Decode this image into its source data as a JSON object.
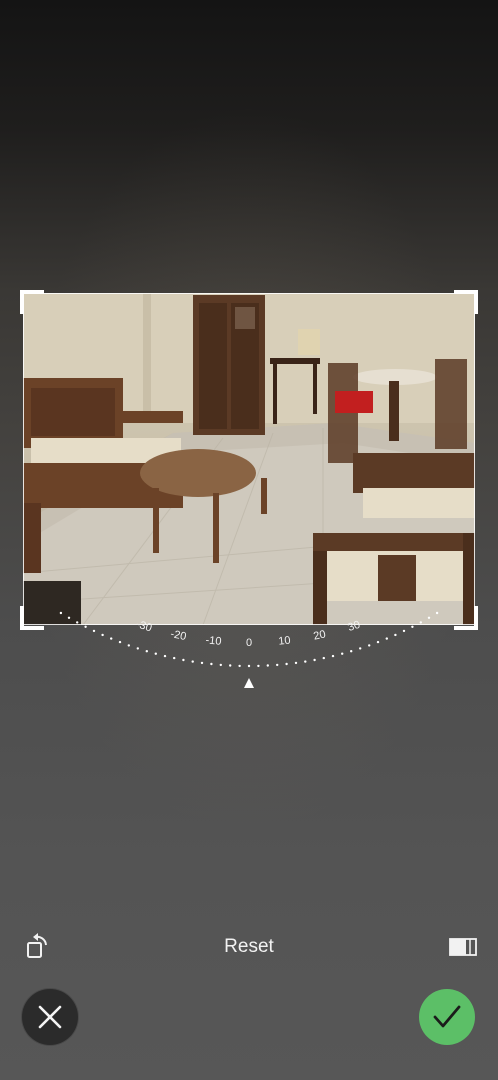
{
  "photo": {
    "subject": "living-room-photo"
  },
  "dial": {
    "ticks": [
      "-30",
      "-20",
      "-10",
      "0",
      "10",
      "20",
      "30"
    ],
    "current_angle": 0
  },
  "toolbar": {
    "reset_label": "Reset",
    "rotate_icon": "rotate-icon",
    "aspect_icon": "aspect-ratio-icon"
  },
  "actions": {
    "cancel_icon": "close-icon",
    "confirm_icon": "checkmark-icon",
    "confirm_color": "#5cbf67",
    "cancel_color": "#2b2b2b"
  }
}
